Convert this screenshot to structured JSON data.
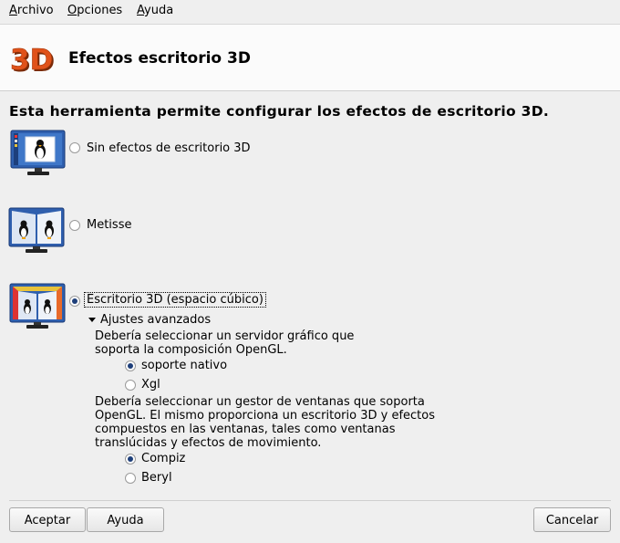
{
  "menu": {
    "items": [
      {
        "label": "Archivo"
      },
      {
        "label": "Opciones"
      },
      {
        "label": "Ayuda"
      }
    ]
  },
  "header": {
    "logo_text": "3D",
    "title": "Efectos escritorio 3D"
  },
  "intro": "Esta herramienta permite configurar los efectos de escritorio 3D.",
  "options": [
    {
      "label": "Sin efectos de escritorio 3D",
      "selected": false,
      "icon": "monitor-single-penguin-icon"
    },
    {
      "label": "Metisse",
      "selected": false,
      "icon": "monitor-two-penguins-icon"
    },
    {
      "label": "Escritorio 3D (espacio cúbico)",
      "selected": true,
      "icon": "monitor-cube-icon"
    }
  ],
  "advanced": {
    "expander_label": "Ajustes avanzados",
    "server_text": "Debería seleccionar un servidor gráfico que soporta la composición OpenGL.",
    "server_options": [
      {
        "label": "soporte nativo",
        "selected": true
      },
      {
        "label": "Xgl",
        "selected": false
      }
    ],
    "wm_text": "Debería seleccionar un gestor de ventanas que soporta OpenGL. El mismo proporciona un escritorio 3D y efectos compuestos en las ventanas, tales como ventanas translúcidas y efectos de movimiento.",
    "wm_options": [
      {
        "label": "Compiz",
        "selected": true
      },
      {
        "label": "Beryl",
        "selected": false
      }
    ]
  },
  "buttons": {
    "ok": "Aceptar",
    "help": "Ayuda",
    "cancel": "Cancelar"
  },
  "colors": {
    "radio_selected": "#1e3f7a",
    "logo": "#e0521a",
    "monitor_blue": "#2f5fae"
  }
}
